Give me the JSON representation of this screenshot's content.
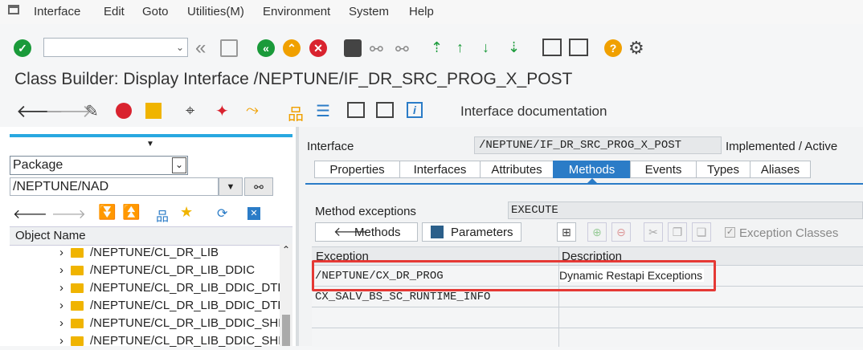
{
  "menu": {
    "items": [
      "Interface",
      "Edit",
      "Goto",
      "Utilities(M)",
      "Environment",
      "System",
      "Help"
    ]
  },
  "title": "Class Builder: Display Interface /NEPTUNE/IF_DR_SRC_PROG_X_POST",
  "appbar": {
    "doc_label": "Interface documentation"
  },
  "left": {
    "object_type": "Package",
    "package": "/NEPTUNE/NAD",
    "column_header": "Object Name",
    "tree_items": [
      "/NEPTUNE/CL_DR_LIB",
      "/NEPTUNE/CL_DR_LIB_DDIC",
      "/NEPTUNE/CL_DR_LIB_DDIC_DTEL",
      "/NEPTUNE/CL_DR_LIB_DDIC_DTEL",
      "/NEPTUNE/CL_DR_LIB_DDIC_SHLP",
      "/NEPTUNE/CL_DR_LIB_DDIC_SHLP"
    ]
  },
  "right": {
    "interface_label": "Interface",
    "interface_name": "/NEPTUNE/IF_DR_SRC_PROG_X_POST",
    "status": "Implemented / Active",
    "tabs": [
      "Properties",
      "Interfaces",
      "Attributes",
      "Methods",
      "Events",
      "Types",
      "Aliases"
    ],
    "method_exceptions_label": "Method exceptions",
    "method_name": "EXECUTE",
    "methods_button": "Methods",
    "parameters_button": "Parameters",
    "exception_classes_label": "Exception Classes",
    "grid": {
      "headers": [
        "Exception",
        "Description"
      ],
      "rows": [
        [
          "/NEPTUNE/CX_DR_PROG",
          "Dynamic Restapi Exceptions"
        ],
        [
          "CX_SALV_BS_SC_RUNTIME_INFO",
          ""
        ]
      ]
    }
  },
  "colors": {
    "accent": "#2b7cc7",
    "highlight": "#e53935",
    "green": "#1a9a3a",
    "orange": "#f0a000",
    "red": "#d9232f"
  }
}
